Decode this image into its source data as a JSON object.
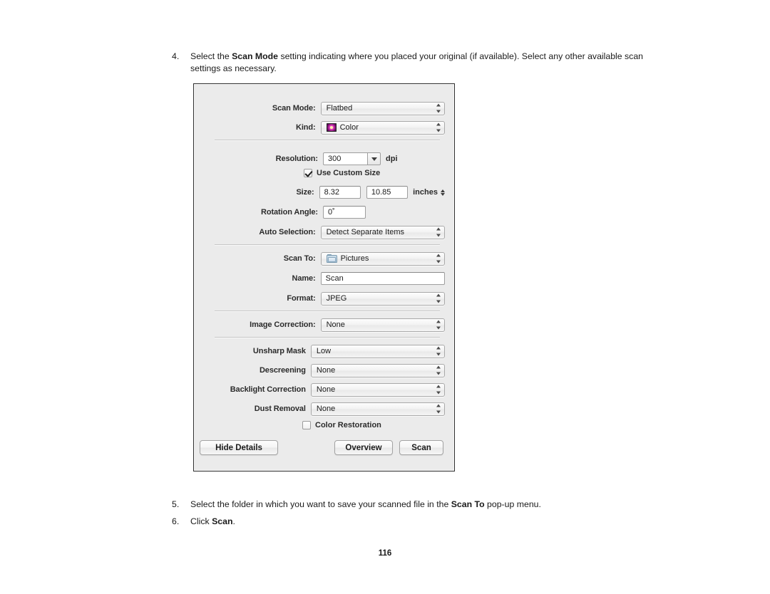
{
  "document": {
    "steps": [
      {
        "number": "4.",
        "parts": [
          {
            "text": "Select the ",
            "bold": false
          },
          {
            "text": "Scan Mode",
            "bold": true
          },
          {
            "text": " setting indicating where you placed your original (if available). Select any other available scan settings as necessary.",
            "bold": false
          }
        ]
      },
      {
        "number": "5.",
        "parts": [
          {
            "text": "Select the folder in which you want to save your scanned file in the ",
            "bold": false
          },
          {
            "text": "Scan To",
            "bold": true
          },
          {
            "text": " pop-up menu.",
            "bold": false
          }
        ]
      },
      {
        "number": "6.",
        "parts": [
          {
            "text": "Click ",
            "bold": false
          },
          {
            "text": "Scan",
            "bold": true
          },
          {
            "text": ".",
            "bold": false
          }
        ]
      }
    ],
    "page_number": "116"
  },
  "scan_dialog": {
    "rows": {
      "scan_mode": {
        "label": "Scan Mode:",
        "value": "Flatbed"
      },
      "kind": {
        "label": "Kind:",
        "value": "Color",
        "icon": "color-thumbnail-icon"
      },
      "resolution": {
        "label": "Resolution:",
        "value": "300",
        "unit": "dpi"
      },
      "use_custom_size": {
        "label": "Use Custom Size",
        "checked": true
      },
      "size": {
        "label": "Size:",
        "width_value": "8.32",
        "height_value": "10.85",
        "unit": "inches"
      },
      "rotation_angle": {
        "label": "Rotation Angle:",
        "value": "0˚"
      },
      "auto_selection": {
        "label": "Auto Selection:",
        "value": "Detect Separate Items"
      },
      "scan_to": {
        "label": "Scan To:",
        "value": "Pictures",
        "icon": "folder-icon"
      },
      "name": {
        "label": "Name:",
        "value": "Scan"
      },
      "format": {
        "label": "Format:",
        "value": "JPEG"
      },
      "image_correction": {
        "label": "Image Correction:",
        "value": "None"
      },
      "unsharp_mask": {
        "label": "Unsharp Mask",
        "value": "Low"
      },
      "descreening": {
        "label": "Descreening",
        "value": "None"
      },
      "backlight_correction": {
        "label": "Backlight Correction",
        "value": "None"
      },
      "dust_removal": {
        "label": "Dust Removal",
        "value": "None"
      },
      "color_restoration": {
        "label": "Color Restoration",
        "checked": false
      }
    },
    "buttons": {
      "hide_details": "Hide Details",
      "overview": "Overview",
      "scan": "Scan"
    },
    "colors": {
      "window_background": "#ebebeb",
      "window_border": "#2e2e2e",
      "divider": "#c6c6c6",
      "field_background": "#ffffff",
      "label_text": "#2b2b2b"
    }
  }
}
